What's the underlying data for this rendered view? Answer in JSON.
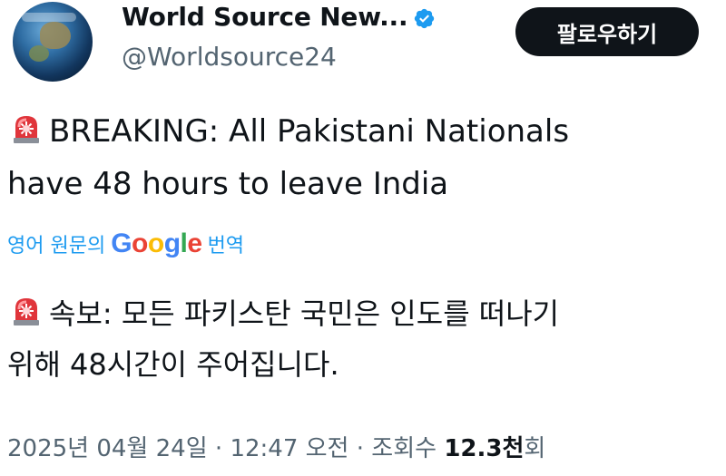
{
  "account": {
    "display_name": "World Source New...",
    "handle": "@Worldsource24",
    "verified_icon": "verified-badge-icon",
    "avatar_icon": "globe-avatar"
  },
  "follow_button": {
    "label": "팔로우하기"
  },
  "tweet": {
    "emoji_icon": "police-siren-emoji",
    "text_line1": "BREAKING: All Pakistani Nationals",
    "text_line2": "have 48 hours to leave India"
  },
  "translation": {
    "prefix": "영어 원문의",
    "brand": "Google",
    "suffix": "번역",
    "text_line1": "속보: 모든 파키스탄 국민은 인도를 떠나기",
    "text_line2": "위해 48시간이 주어집니다."
  },
  "meta": {
    "date": "2025년 04월 24일",
    "time": "12:47 오전",
    "views_label": "조회수",
    "views_count": "12.3천",
    "views_suffix": "회"
  },
  "colors": {
    "text": "#0f1419",
    "secondary": "#536471",
    "link": "#1d9bf0",
    "verified": "#1d9bf0",
    "button_bg": "#0f1419"
  }
}
